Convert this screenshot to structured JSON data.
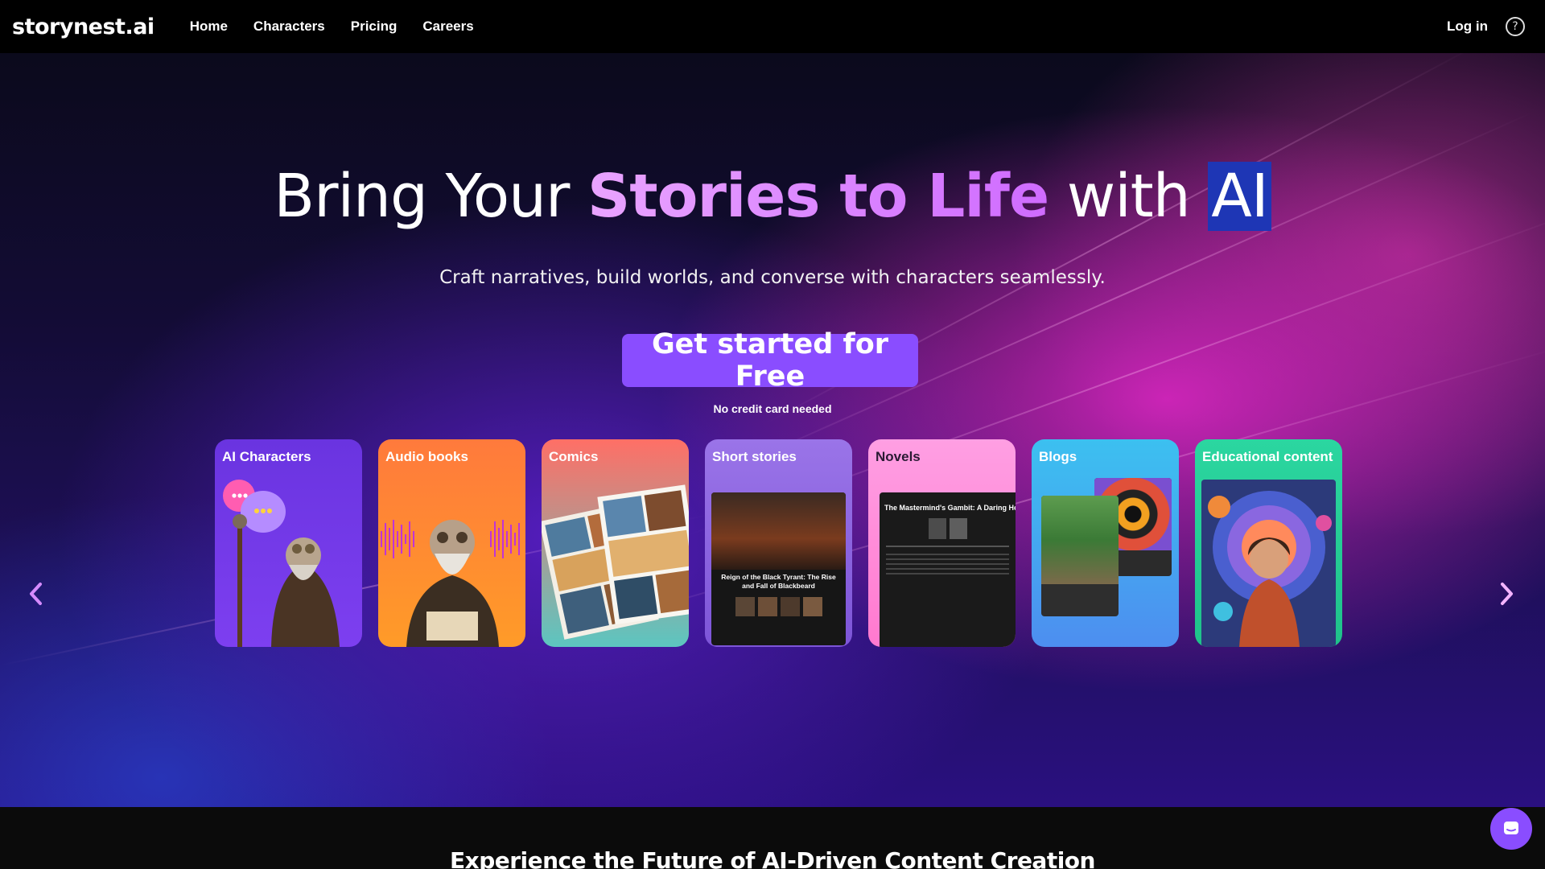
{
  "nav": {
    "logo": "storynest.ai",
    "links": [
      "Home",
      "Characters",
      "Pricing",
      "Careers"
    ],
    "login": "Log in",
    "help_icon": "question-circle-icon"
  },
  "hero": {
    "headline_before": "Bring Your ",
    "headline_highlight": "Stories to Life",
    "headline_with": " with ",
    "headline_ai": "AI",
    "subhead": "Craft narratives, build worlds, and converse with characters seamlessly.",
    "cta_label": "Get started for Free",
    "cta_note": "No credit card needed"
  },
  "carousel": {
    "cards": [
      {
        "label": "AI Characters"
      },
      {
        "label": "Audio books"
      },
      {
        "label": "Comics"
      },
      {
        "label": "Short stories",
        "screen_title": "Reign of the Black Tyrant: The Rise and Fall of Blackbeard"
      },
      {
        "label": "Novels",
        "screen_title": "The Mastermind's Gambit: A Daring Heist S"
      },
      {
        "label": "Blogs"
      },
      {
        "label": "Educational content"
      }
    ],
    "prev_icon": "chevron-left-icon",
    "next_icon": "chevron-right-icon"
  },
  "section": {
    "title": "Experience the Future of AI-Driven Content Creation"
  },
  "chat": {
    "icon": "chat-bubble-icon"
  },
  "colors": {
    "accent": "#8a4dff",
    "highlight_text": "#e58bff",
    "ai_highlight_bg": "#1e36b5"
  }
}
